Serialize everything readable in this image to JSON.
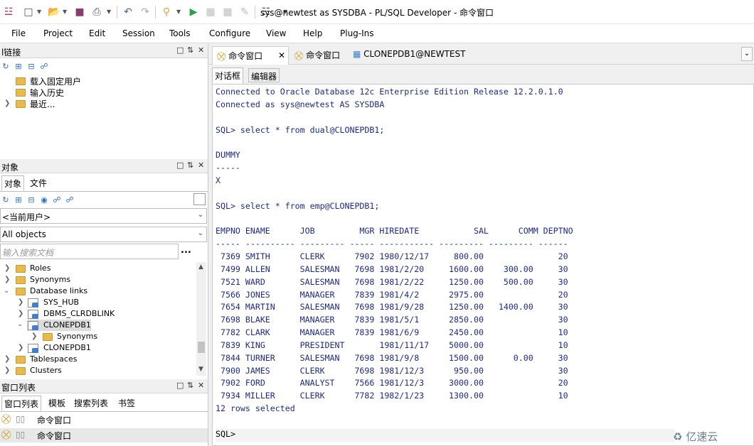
{
  "window": {
    "title": "sys@newtest as SYSDBA - PL/SQL Developer - 命令窗口"
  },
  "menu": [
    "File",
    "Project",
    "Edit",
    "Session",
    "Tools",
    "Configure",
    "View",
    "Help",
    "Plug-Ins"
  ],
  "connections_panel": {
    "title": "l链接",
    "items": [
      "载入固定用户",
      "输入历史",
      "最近..."
    ]
  },
  "objects_panel": {
    "title": "对象",
    "tabs": [
      "对象",
      "文件"
    ],
    "user_select": "<当前用户>",
    "filter_select": "All objects",
    "search_placeholder": "输入搜索文档",
    "search_more": "...",
    "tree": [
      "Roles",
      "Synonyms",
      "Database links",
      "SYS_HUB",
      "DBMS_CLRDBLINK",
      "CLONEPDB1",
      "Synonyms",
      "CLONEPDB1",
      "Tablespaces",
      "Clusters"
    ]
  },
  "window_list_panel": {
    "title": "窗口列表",
    "tabs": [
      "窗口列表",
      "模板",
      "搜索列表",
      "书签"
    ],
    "items": [
      "命令窗口",
      "命令窗口"
    ]
  },
  "doc_tabs": [
    "命令窗口",
    "命令窗口",
    "CLONEPDB1@NEWTEST"
  ],
  "sub_tabs": [
    "对话框",
    "编辑器"
  ],
  "sql_output": [
    "Connected to Oracle Database 12c Enterprise Edition Release 12.2.0.1.0",
    "Connected as sys@newtest AS SYSDBA",
    "",
    "SQL> select * from dual@CLONEPDB1;",
    "",
    "DUMMY",
    "-----",
    "X",
    "",
    "SQL> select * from emp@CLONEPDB1;",
    "",
    "EMPNO ENAME      JOB         MGR HIREDATE           SAL      COMM DEPTNO",
    "----- ---------- --------- ----- ----------- --------- --------- ------",
    " 7369 SMITH      CLERK      7902 1980/12/17     800.00               20",
    " 7499 ALLEN      SALESMAN   7698 1981/2/20     1600.00    300.00     30",
    " 7521 WARD       SALESMAN   7698 1981/2/22     1250.00    500.00     30",
    " 7566 JONES      MANAGER    7839 1981/4/2      2975.00               20",
    " 7654 MARTIN     SALESMAN   7698 1981/9/28     1250.00   1400.00     30",
    " 7698 BLAKE      MANAGER    7839 1981/5/1      2850.00               30",
    " 7782 CLARK      MANAGER    7839 1981/6/9      2450.00               10",
    " 7839 KING       PRESIDENT       1981/11/17    5000.00               10",
    " 7844 TURNER     SALESMAN   7698 1981/9/8      1500.00      0.00     30",
    " 7900 JAMES      CLERK      7698 1981/12/3      950.00               30",
    " 7902 FORD       ANALYST    7566 1981/12/3     3000.00               20",
    " 7934 MILLER     CLERK      7782 1982/1/23     1300.00               10",
    "12 rows selected"
  ],
  "sql_prompt": "SQL>",
  "watermark": "亿速云"
}
